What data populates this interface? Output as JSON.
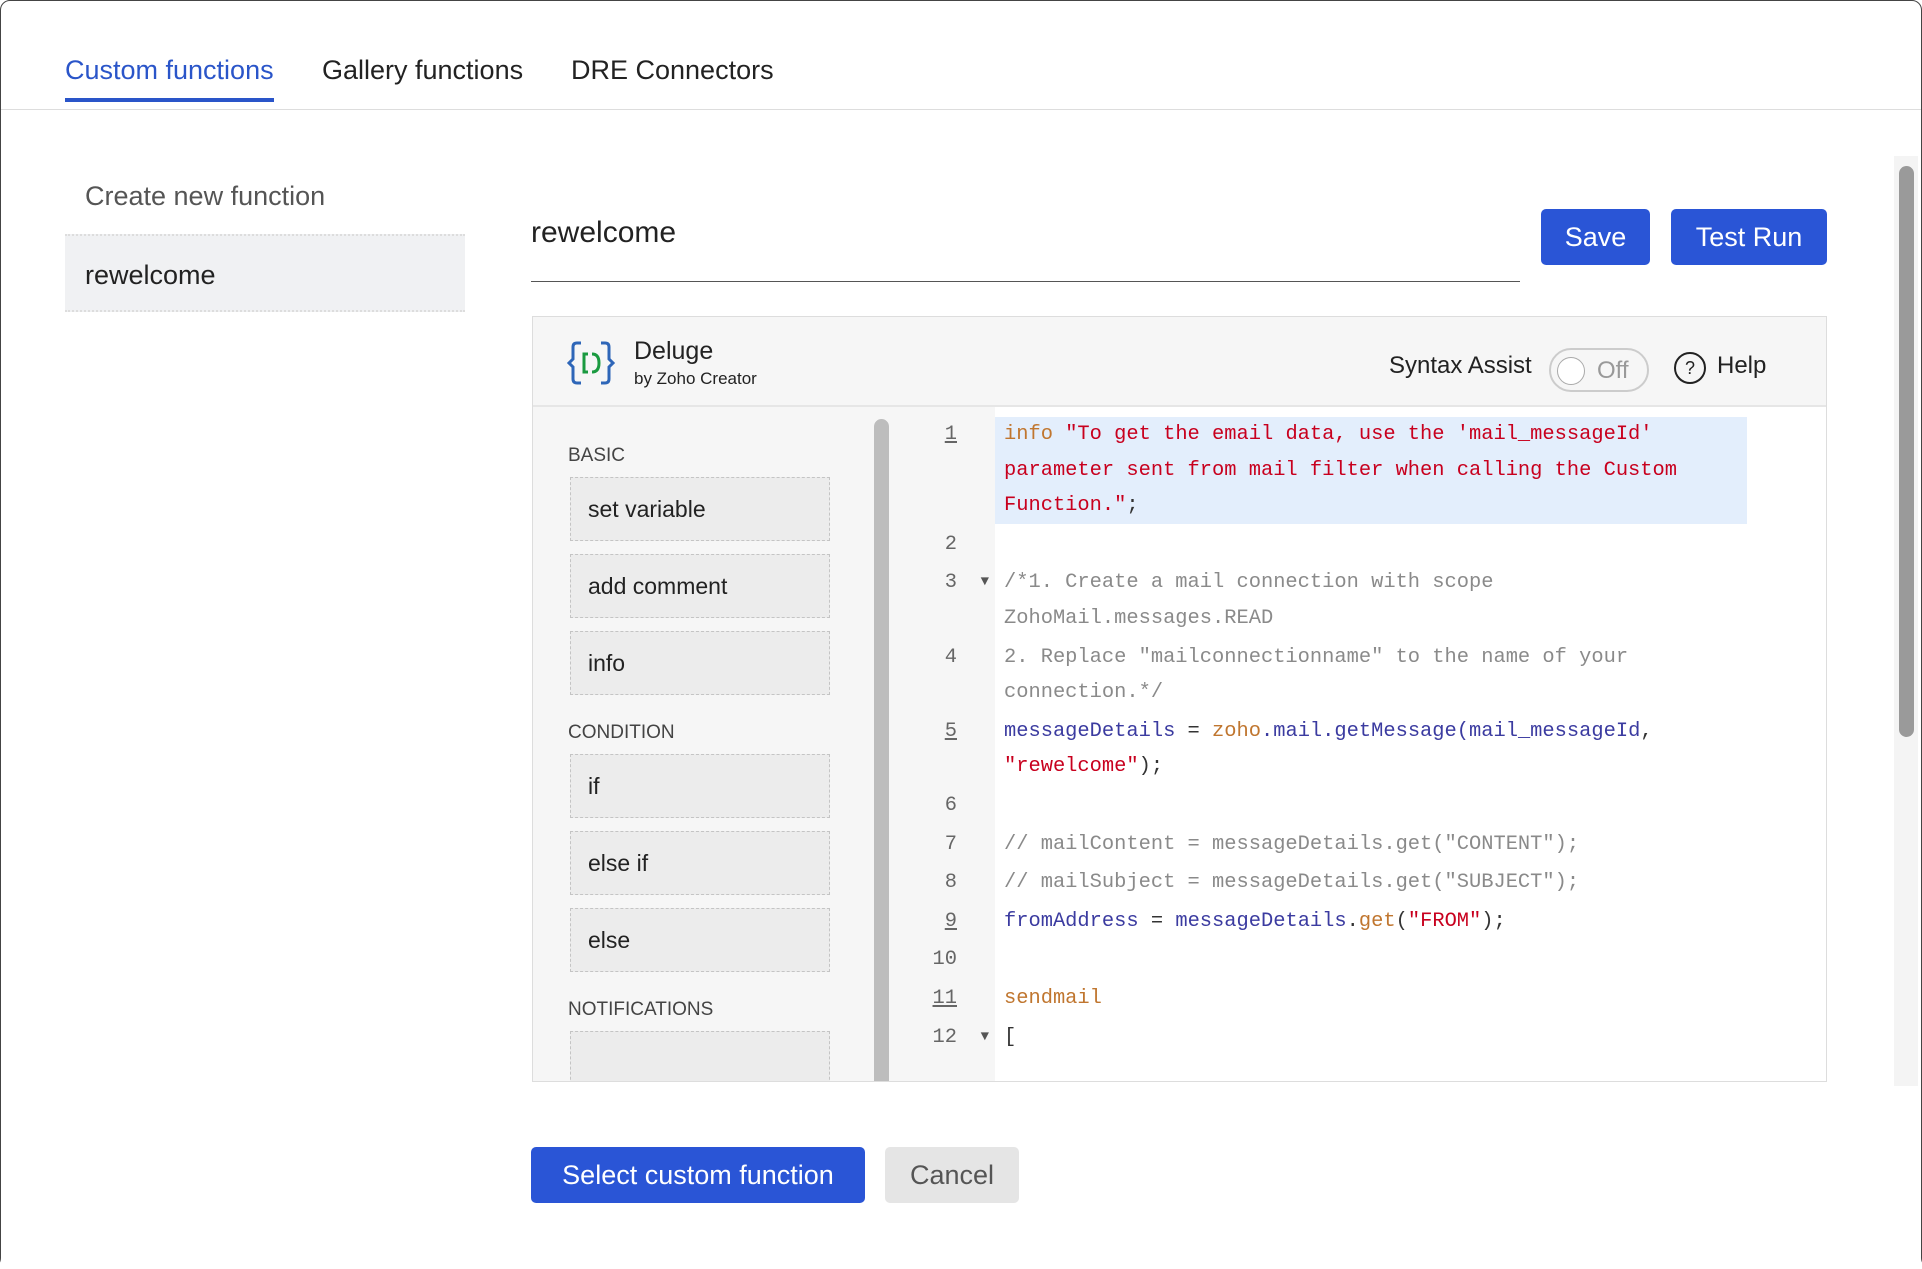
{
  "tabs": [
    {
      "label": "Custom functions",
      "active": true
    },
    {
      "label": "Gallery functions"
    },
    {
      "label": "DRE Connectors"
    }
  ],
  "sidebar": {
    "create_label": "Create new function",
    "items": [
      {
        "label": "rewelcome",
        "selected": true
      }
    ]
  },
  "function_name": "rewelcome",
  "toolbar": {
    "save_label": "Save",
    "test_run_label": "Test Run"
  },
  "editor": {
    "brand_title": "Deluge",
    "brand_subtitle": "by Zoho Creator",
    "syntax_assist_label": "Syntax Assist",
    "syntax_assist_state": "Off",
    "help_label": "Help",
    "palette": [
      {
        "section": "BASIC",
        "items": [
          "set variable",
          "add comment",
          "info"
        ]
      },
      {
        "section": "CONDITION",
        "items": [
          "if",
          "else if",
          "else"
        ]
      },
      {
        "section": "NOTIFICATIONS",
        "items": [
          ""
        ]
      }
    ],
    "colors": {
      "keyword": "#c0762f",
      "string": "#c8001e",
      "comment": "#8a8a8a",
      "variable": "#3b3ba0",
      "plain": "#333333",
      "accent": "#2a55d6"
    },
    "lines": [
      {
        "num": "1",
        "u": true,
        "hl": true,
        "tokens": [
          [
            "keyword",
            "info "
          ],
          [
            "string",
            "\"To get the email data, use the 'mail_messageId' parameter sent from mail filter when calling the Custom Function.\""
          ],
          [
            "plain",
            ";"
          ]
        ]
      },
      {
        "num": "2",
        "tokens": []
      },
      {
        "num": "3",
        "fold": true,
        "tokens": [
          [
            "comment",
            "/*1. Create a mail connection with scope ZohoMail.messages.READ"
          ]
        ]
      },
      {
        "num": "4",
        "tokens": [
          [
            "comment",
            "2. Replace \"mailconnectionname\" to the name of your connection.*/"
          ]
        ]
      },
      {
        "num": "5",
        "u": true,
        "tokens": [
          [
            "variable",
            "messageDetails"
          ],
          [
            "plain",
            " = "
          ],
          [
            "keyword",
            "zoho"
          ],
          [
            "variable",
            ".mail.getMessage(mail_messageId"
          ],
          [
            "plain",
            ", "
          ],
          [
            "string",
            "\"rewelcome\""
          ],
          [
            "plain",
            ");"
          ]
        ]
      },
      {
        "num": "6",
        "tokens": []
      },
      {
        "num": "7",
        "tokens": [
          [
            "comment",
            "// mailContent = messageDetails.get(\"CONTENT\");"
          ]
        ]
      },
      {
        "num": "8",
        "tokens": [
          [
            "comment",
            "// mailSubject = messageDetails.get(\"SUBJECT\");"
          ]
        ]
      },
      {
        "num": "9",
        "u": true,
        "tokens": [
          [
            "variable",
            "fromAddress"
          ],
          [
            "plain",
            " = "
          ],
          [
            "variable",
            "messageDetails"
          ],
          [
            "plain",
            "."
          ],
          [
            "keyword",
            "get"
          ],
          [
            "plain",
            "("
          ],
          [
            "string",
            "\"FROM\""
          ],
          [
            "plain",
            ");"
          ]
        ]
      },
      {
        "num": "10",
        "tokens": []
      },
      {
        "num": "11",
        "u": true,
        "tokens": [
          [
            "keyword",
            "sendmail"
          ]
        ]
      },
      {
        "num": "12",
        "fold": true,
        "tokens": [
          [
            "plain",
            "["
          ]
        ]
      }
    ]
  },
  "footer": {
    "select_label": "Select custom function",
    "cancel_label": "Cancel"
  }
}
